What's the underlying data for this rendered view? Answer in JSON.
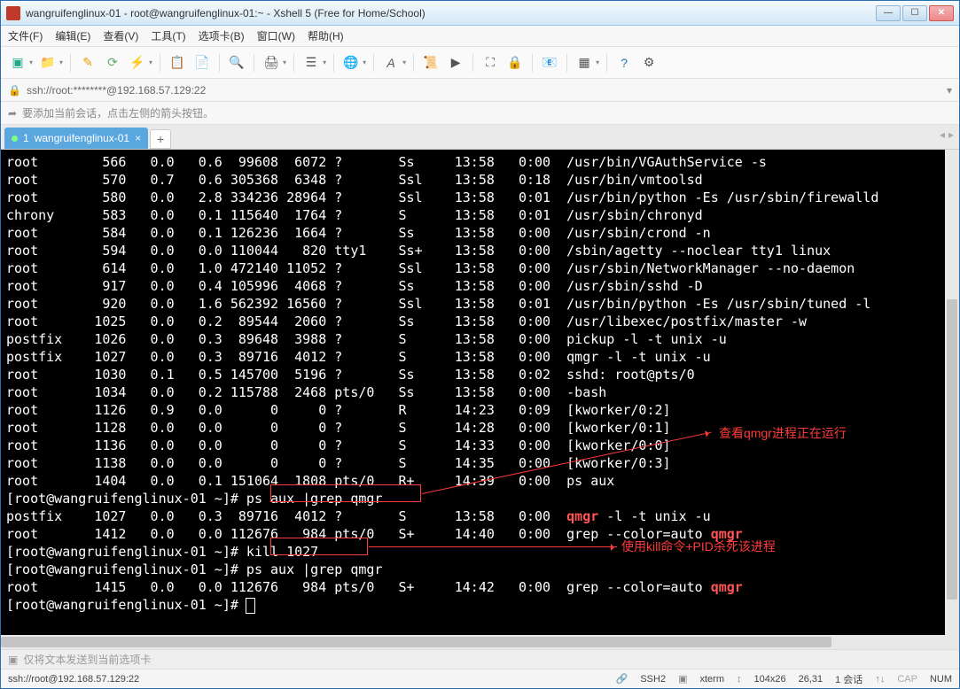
{
  "window": {
    "title": "wangruifenglinux-01 - root@wangruifenglinux-01:~ - Xshell 5 (Free for Home/School)"
  },
  "menu": {
    "file": "文件(F)",
    "edit": "编辑(E)",
    "view": "查看(V)",
    "tools": "工具(T)",
    "tab": "选项卡(B)",
    "window": "窗口(W)",
    "help": "帮助(H)"
  },
  "address": {
    "text": "ssh://root:********@192.168.57.129:22"
  },
  "tip": {
    "text": "要添加当前会话，点击左侧的箭头按钮。"
  },
  "tab": {
    "index": "1",
    "name": "wangruifenglinux-01"
  },
  "annotation1": "查看qmgr进程正在运行",
  "annotation2": "使用kill命令+PID杀死该进程",
  "ps_rows": [
    {
      "user": "root",
      "pid": "566",
      "cpu": "0.0",
      "mem": "0.6",
      "vsz": "99608",
      "rss": "6072",
      "tty": "?",
      "stat": "Ss",
      "start": "13:58",
      "time": "0:00",
      "cmd": "/usr/bin/VGAuthService -s"
    },
    {
      "user": "root",
      "pid": "570",
      "cpu": "0.7",
      "mem": "0.6",
      "vsz": "305368",
      "rss": "6348",
      "tty": "?",
      "stat": "Ssl",
      "start": "13:58",
      "time": "0:18",
      "cmd": "/usr/bin/vmtoolsd"
    },
    {
      "user": "root",
      "pid": "580",
      "cpu": "0.0",
      "mem": "2.8",
      "vsz": "334236",
      "rss": "28964",
      "tty": "?",
      "stat": "Ssl",
      "start": "13:58",
      "time": "0:01",
      "cmd": "/usr/bin/python -Es /usr/sbin/firewalld"
    },
    {
      "user": "chrony",
      "pid": "583",
      "cpu": "0.0",
      "mem": "0.1",
      "vsz": "115640",
      "rss": "1764",
      "tty": "?",
      "stat": "S",
      "start": "13:58",
      "time": "0:01",
      "cmd": "/usr/sbin/chronyd"
    },
    {
      "user": "root",
      "pid": "584",
      "cpu": "0.0",
      "mem": "0.1",
      "vsz": "126236",
      "rss": "1664",
      "tty": "?",
      "stat": "Ss",
      "start": "13:58",
      "time": "0:00",
      "cmd": "/usr/sbin/crond -n"
    },
    {
      "user": "root",
      "pid": "594",
      "cpu": "0.0",
      "mem": "0.0",
      "vsz": "110044",
      "rss": "820",
      "tty": "tty1",
      "stat": "Ss+",
      "start": "13:58",
      "time": "0:00",
      "cmd": "/sbin/agetty --noclear tty1 linux"
    },
    {
      "user": "root",
      "pid": "614",
      "cpu": "0.0",
      "mem": "1.0",
      "vsz": "472140",
      "rss": "11052",
      "tty": "?",
      "stat": "Ssl",
      "start": "13:58",
      "time": "0:00",
      "cmd": "/usr/sbin/NetworkManager --no-daemon"
    },
    {
      "user": "root",
      "pid": "917",
      "cpu": "0.0",
      "mem": "0.4",
      "vsz": "105996",
      "rss": "4068",
      "tty": "?",
      "stat": "Ss",
      "start": "13:58",
      "time": "0:00",
      "cmd": "/usr/sbin/sshd -D"
    },
    {
      "user": "root",
      "pid": "920",
      "cpu": "0.0",
      "mem": "1.6",
      "vsz": "562392",
      "rss": "16560",
      "tty": "?",
      "stat": "Ssl",
      "start": "13:58",
      "time": "0:01",
      "cmd": "/usr/bin/python -Es /usr/sbin/tuned -l"
    },
    {
      "user": "root",
      "pid": "1025",
      "cpu": "0.0",
      "mem": "0.2",
      "vsz": "89544",
      "rss": "2060",
      "tty": "?",
      "stat": "Ss",
      "start": "13:58",
      "time": "0:00",
      "cmd": "/usr/libexec/postfix/master -w"
    },
    {
      "user": "postfix",
      "pid": "1026",
      "cpu": "0.0",
      "mem": "0.3",
      "vsz": "89648",
      "rss": "3988",
      "tty": "?",
      "stat": "S",
      "start": "13:58",
      "time": "0:00",
      "cmd": "pickup -l -t unix -u"
    },
    {
      "user": "postfix",
      "pid": "1027",
      "cpu": "0.0",
      "mem": "0.3",
      "vsz": "89716",
      "rss": "4012",
      "tty": "?",
      "stat": "S",
      "start": "13:58",
      "time": "0:00",
      "cmd": "qmgr -l -t unix -u"
    },
    {
      "user": "root",
      "pid": "1030",
      "cpu": "0.1",
      "mem": "0.5",
      "vsz": "145700",
      "rss": "5196",
      "tty": "?",
      "stat": "Ss",
      "start": "13:58",
      "time": "0:02",
      "cmd": "sshd: root@pts/0"
    },
    {
      "user": "root",
      "pid": "1034",
      "cpu": "0.0",
      "mem": "0.2",
      "vsz": "115788",
      "rss": "2468",
      "tty": "pts/0",
      "stat": "Ss",
      "start": "13:58",
      "time": "0:00",
      "cmd": "-bash"
    },
    {
      "user": "root",
      "pid": "1126",
      "cpu": "0.9",
      "mem": "0.0",
      "vsz": "0",
      "rss": "0",
      "tty": "?",
      "stat": "R",
      "start": "14:23",
      "time": "0:09",
      "cmd": "[kworker/0:2]"
    },
    {
      "user": "root",
      "pid": "1128",
      "cpu": "0.0",
      "mem": "0.0",
      "vsz": "0",
      "rss": "0",
      "tty": "?",
      "stat": "S",
      "start": "14:28",
      "time": "0:00",
      "cmd": "[kworker/0:1]"
    },
    {
      "user": "root",
      "pid": "1136",
      "cpu": "0.0",
      "mem": "0.0",
      "vsz": "0",
      "rss": "0",
      "tty": "?",
      "stat": "S",
      "start": "14:33",
      "time": "0:00",
      "cmd": "[kworker/0:0]"
    },
    {
      "user": "root",
      "pid": "1138",
      "cpu": "0.0",
      "mem": "0.0",
      "vsz": "0",
      "rss": "0",
      "tty": "?",
      "stat": "S",
      "start": "14:35",
      "time": "0:00",
      "cmd": "[kworker/0:3]"
    },
    {
      "user": "root",
      "pid": "1404",
      "cpu": "0.0",
      "mem": "0.1",
      "vsz": "151064",
      "rss": "1808",
      "tty": "pts/0",
      "stat": "R+",
      "start": "14:39",
      "time": "0:00",
      "cmd": "ps aux"
    }
  ],
  "prompt_host": "[root@wangruifenglinux-01 ~]# ",
  "cmd1": "ps aux |grep qmgr",
  "grep1": [
    {
      "user": "postfix",
      "pid": "1027",
      "cpu": "0.0",
      "mem": "0.3",
      "vsz": "89716",
      "rss": "4012",
      "tty": "?",
      "stat": "S",
      "start": "13:58",
      "time": "0:00",
      "cmd_pre": "",
      "match": "qmgr",
      "cmd_post": " -l -t unix -u"
    },
    {
      "user": "root",
      "pid": "1412",
      "cpu": "0.0",
      "mem": "0.0",
      "vsz": "112676",
      "rss": "984",
      "tty": "pts/0",
      "stat": "S+",
      "start": "14:40",
      "time": "0:00",
      "cmd_pre": "grep --color=auto ",
      "match": "qmgr",
      "cmd_post": ""
    }
  ],
  "cmd2": "kill 1027",
  "cmd3": "ps aux |grep qmgr",
  "grep2": [
    {
      "user": "root",
      "pid": "1415",
      "cpu": "0.0",
      "mem": "0.0",
      "vsz": "112676",
      "rss": "984",
      "tty": "pts/0",
      "stat": "S+",
      "start": "14:42",
      "time": "0:00",
      "cmd_pre": "grep --color=auto ",
      "match": "qmgr",
      "cmd_post": ""
    }
  ],
  "sendbar": "仅将文本发送到当前选项卡",
  "status": {
    "left": "ssh://root@192.168.57.129:22",
    "ssh": "SSH2",
    "term": "xterm",
    "size": "104x26",
    "pos": "26,31",
    "sessions": "1 会话",
    "cap": "CAP",
    "num": "NUM"
  }
}
